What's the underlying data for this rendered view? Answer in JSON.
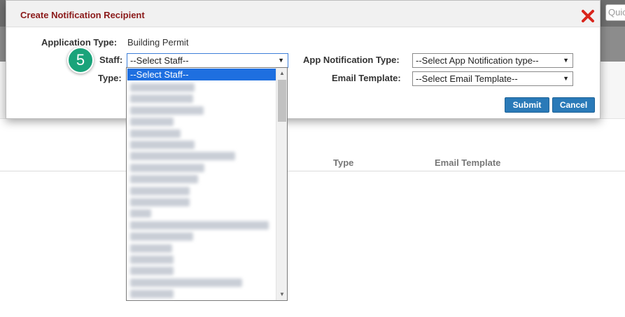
{
  "background": {
    "quick_search_placeholder": "Quic",
    "columns": [
      "Type",
      "Email Template"
    ]
  },
  "dialog": {
    "title": "Create Notification Recipient",
    "close_icon": "close-icon",
    "application_type": {
      "label": "Application Type:",
      "value": "Building Permit"
    },
    "staff": {
      "label": "Staff:",
      "selected": "--Select Staff--"
    },
    "type": {
      "label": "Type:"
    },
    "app_notification_type": {
      "label": "App Notification Type:",
      "selected": "--Select App Notification type--"
    },
    "email_template": {
      "label": "Email Template:",
      "selected": "--Select Email Template--"
    },
    "submit_label": "Submit",
    "cancel_label": "Cancel"
  },
  "step_badge": "5",
  "staff_dropdown": {
    "highlighted": "--Select Staff--",
    "blurred_item_count": 19
  },
  "colors": {
    "title": "#8b1a1a",
    "button": "#2a7ab8",
    "badge": "#1aa37a",
    "highlight": "#1e6fe0"
  }
}
